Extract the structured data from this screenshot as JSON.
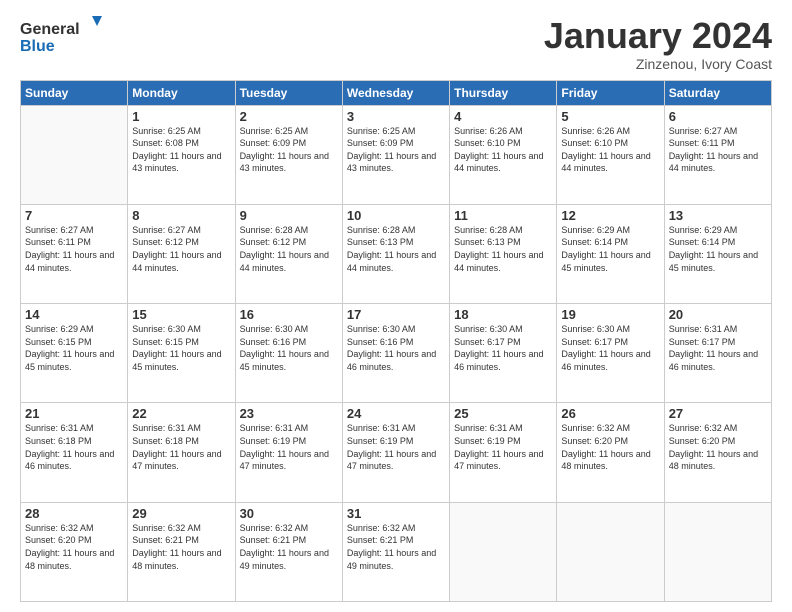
{
  "header": {
    "logo_line1": "General",
    "logo_line2": "Blue",
    "month_title": "January 2024",
    "subtitle": "Zinzenou, Ivory Coast"
  },
  "days_of_week": [
    "Sunday",
    "Monday",
    "Tuesday",
    "Wednesday",
    "Thursday",
    "Friday",
    "Saturday"
  ],
  "weeks": [
    [
      {
        "day": "",
        "sunrise": "",
        "sunset": "",
        "daylight": ""
      },
      {
        "day": "1",
        "sunrise": "Sunrise: 6:25 AM",
        "sunset": "Sunset: 6:08 PM",
        "daylight": "Daylight: 11 hours and 43 minutes."
      },
      {
        "day": "2",
        "sunrise": "Sunrise: 6:25 AM",
        "sunset": "Sunset: 6:09 PM",
        "daylight": "Daylight: 11 hours and 43 minutes."
      },
      {
        "day": "3",
        "sunrise": "Sunrise: 6:25 AM",
        "sunset": "Sunset: 6:09 PM",
        "daylight": "Daylight: 11 hours and 43 minutes."
      },
      {
        "day": "4",
        "sunrise": "Sunrise: 6:26 AM",
        "sunset": "Sunset: 6:10 PM",
        "daylight": "Daylight: 11 hours and 44 minutes."
      },
      {
        "day": "5",
        "sunrise": "Sunrise: 6:26 AM",
        "sunset": "Sunset: 6:10 PM",
        "daylight": "Daylight: 11 hours and 44 minutes."
      },
      {
        "day": "6",
        "sunrise": "Sunrise: 6:27 AM",
        "sunset": "Sunset: 6:11 PM",
        "daylight": "Daylight: 11 hours and 44 minutes."
      }
    ],
    [
      {
        "day": "7",
        "sunrise": "Sunrise: 6:27 AM",
        "sunset": "Sunset: 6:11 PM",
        "daylight": "Daylight: 11 hours and 44 minutes."
      },
      {
        "day": "8",
        "sunrise": "Sunrise: 6:27 AM",
        "sunset": "Sunset: 6:12 PM",
        "daylight": "Daylight: 11 hours and 44 minutes."
      },
      {
        "day": "9",
        "sunrise": "Sunrise: 6:28 AM",
        "sunset": "Sunset: 6:12 PM",
        "daylight": "Daylight: 11 hours and 44 minutes."
      },
      {
        "day": "10",
        "sunrise": "Sunrise: 6:28 AM",
        "sunset": "Sunset: 6:13 PM",
        "daylight": "Daylight: 11 hours and 44 minutes."
      },
      {
        "day": "11",
        "sunrise": "Sunrise: 6:28 AM",
        "sunset": "Sunset: 6:13 PM",
        "daylight": "Daylight: 11 hours and 44 minutes."
      },
      {
        "day": "12",
        "sunrise": "Sunrise: 6:29 AM",
        "sunset": "Sunset: 6:14 PM",
        "daylight": "Daylight: 11 hours and 45 minutes."
      },
      {
        "day": "13",
        "sunrise": "Sunrise: 6:29 AM",
        "sunset": "Sunset: 6:14 PM",
        "daylight": "Daylight: 11 hours and 45 minutes."
      }
    ],
    [
      {
        "day": "14",
        "sunrise": "Sunrise: 6:29 AM",
        "sunset": "Sunset: 6:15 PM",
        "daylight": "Daylight: 11 hours and 45 minutes."
      },
      {
        "day": "15",
        "sunrise": "Sunrise: 6:30 AM",
        "sunset": "Sunset: 6:15 PM",
        "daylight": "Daylight: 11 hours and 45 minutes."
      },
      {
        "day": "16",
        "sunrise": "Sunrise: 6:30 AM",
        "sunset": "Sunset: 6:16 PM",
        "daylight": "Daylight: 11 hours and 45 minutes."
      },
      {
        "day": "17",
        "sunrise": "Sunrise: 6:30 AM",
        "sunset": "Sunset: 6:16 PM",
        "daylight": "Daylight: 11 hours and 46 minutes."
      },
      {
        "day": "18",
        "sunrise": "Sunrise: 6:30 AM",
        "sunset": "Sunset: 6:17 PM",
        "daylight": "Daylight: 11 hours and 46 minutes."
      },
      {
        "day": "19",
        "sunrise": "Sunrise: 6:30 AM",
        "sunset": "Sunset: 6:17 PM",
        "daylight": "Daylight: 11 hours and 46 minutes."
      },
      {
        "day": "20",
        "sunrise": "Sunrise: 6:31 AM",
        "sunset": "Sunset: 6:17 PM",
        "daylight": "Daylight: 11 hours and 46 minutes."
      }
    ],
    [
      {
        "day": "21",
        "sunrise": "Sunrise: 6:31 AM",
        "sunset": "Sunset: 6:18 PM",
        "daylight": "Daylight: 11 hours and 46 minutes."
      },
      {
        "day": "22",
        "sunrise": "Sunrise: 6:31 AM",
        "sunset": "Sunset: 6:18 PM",
        "daylight": "Daylight: 11 hours and 47 minutes."
      },
      {
        "day": "23",
        "sunrise": "Sunrise: 6:31 AM",
        "sunset": "Sunset: 6:19 PM",
        "daylight": "Daylight: 11 hours and 47 minutes."
      },
      {
        "day": "24",
        "sunrise": "Sunrise: 6:31 AM",
        "sunset": "Sunset: 6:19 PM",
        "daylight": "Daylight: 11 hours and 47 minutes."
      },
      {
        "day": "25",
        "sunrise": "Sunrise: 6:31 AM",
        "sunset": "Sunset: 6:19 PM",
        "daylight": "Daylight: 11 hours and 47 minutes."
      },
      {
        "day": "26",
        "sunrise": "Sunrise: 6:32 AM",
        "sunset": "Sunset: 6:20 PM",
        "daylight": "Daylight: 11 hours and 48 minutes."
      },
      {
        "day": "27",
        "sunrise": "Sunrise: 6:32 AM",
        "sunset": "Sunset: 6:20 PM",
        "daylight": "Daylight: 11 hours and 48 minutes."
      }
    ],
    [
      {
        "day": "28",
        "sunrise": "Sunrise: 6:32 AM",
        "sunset": "Sunset: 6:20 PM",
        "daylight": "Daylight: 11 hours and 48 minutes."
      },
      {
        "day": "29",
        "sunrise": "Sunrise: 6:32 AM",
        "sunset": "Sunset: 6:21 PM",
        "daylight": "Daylight: 11 hours and 48 minutes."
      },
      {
        "day": "30",
        "sunrise": "Sunrise: 6:32 AM",
        "sunset": "Sunset: 6:21 PM",
        "daylight": "Daylight: 11 hours and 49 minutes."
      },
      {
        "day": "31",
        "sunrise": "Sunrise: 6:32 AM",
        "sunset": "Sunset: 6:21 PM",
        "daylight": "Daylight: 11 hours and 49 minutes."
      },
      {
        "day": "",
        "sunrise": "",
        "sunset": "",
        "daylight": ""
      },
      {
        "day": "",
        "sunrise": "",
        "sunset": "",
        "daylight": ""
      },
      {
        "day": "",
        "sunrise": "",
        "sunset": "",
        "daylight": ""
      }
    ]
  ]
}
